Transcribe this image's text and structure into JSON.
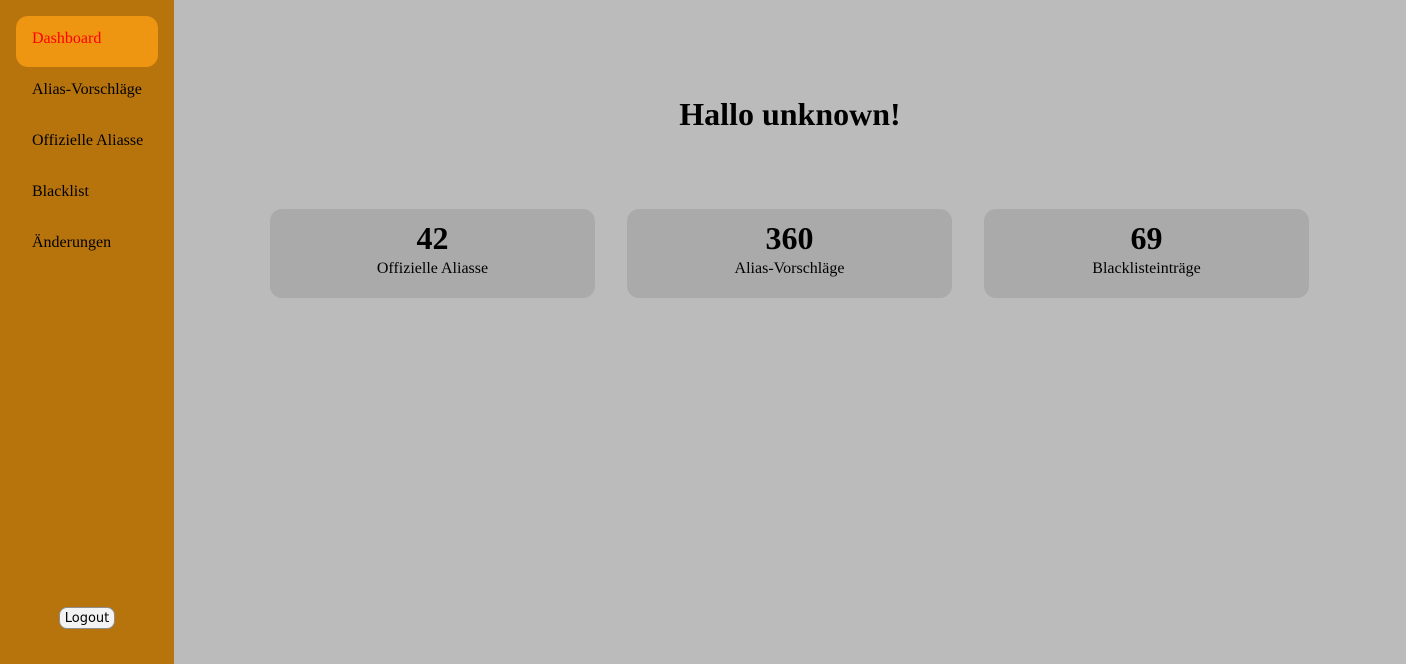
{
  "sidebar": {
    "items": [
      {
        "label": "Dashboard",
        "active": true
      },
      {
        "label": "Alias-Vorschläge",
        "active": false
      },
      {
        "label": "Offizielle Aliasse",
        "active": false
      },
      {
        "label": "Blacklist",
        "active": false
      },
      {
        "label": "Änderungen",
        "active": false
      }
    ],
    "logout_label": "Logout"
  },
  "main": {
    "greeting": "Hallo unknown!",
    "stats": [
      {
        "value": "42",
        "label": "Offizielle Aliasse"
      },
      {
        "value": "360",
        "label": "Alias-Vorschläge"
      },
      {
        "value": "69",
        "label": "Blacklisteinträge"
      }
    ]
  },
  "colors": {
    "sidebar_bg": "#b8740c",
    "active_item_bg": "#ee9512",
    "active_item_text": "#ff0000",
    "main_bg": "#bbbbbb",
    "card_bg": "#aaaaaa"
  }
}
